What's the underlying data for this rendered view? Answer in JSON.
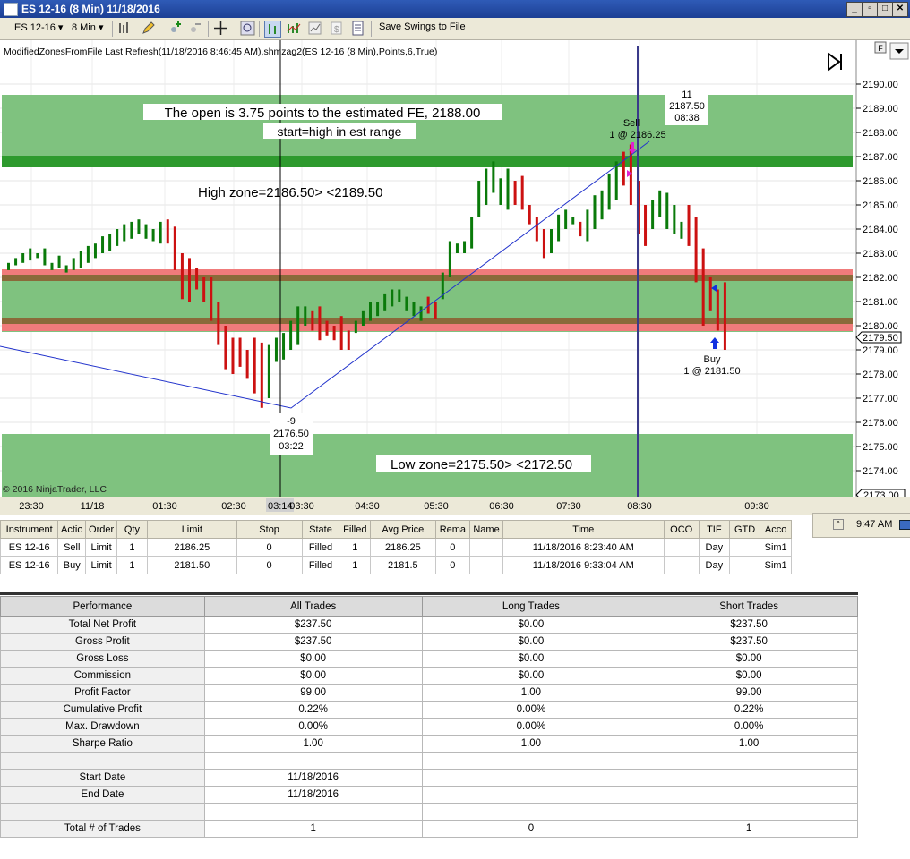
{
  "window": {
    "title": "ES 12-16 (8 Min)  11/18/2016"
  },
  "toolbar": {
    "instrument": "ES 12-16",
    "interval": "8 Min",
    "save_swings": "Save Swings to File"
  },
  "chart": {
    "indicator_label": "ModifiedZonesFromFile Last Refresh(11/18/2016 8:46:45 AM),shmzag2(ES 12-16 (8 Min),Points,6,True)",
    "copyright": "© 2016 NinjaTrader, LLC",
    "panel_button": "F",
    "text_open": "The open is 3.75 points to the estimated FE, 2188.00",
    "text_start": "start=high in est range",
    "text_high_zone": "High  zone=2186.50>  <2189.50",
    "text_low_zone": "Low  zone=2175.50>  <2172.50",
    "swing_high": {
      "count": "11",
      "price": "2187.50",
      "time": "08:38"
    },
    "swing_low": {
      "count": "-9",
      "price": "2176.50",
      "time": "03:22"
    },
    "sell_label": "Sell",
    "sell_fill": "1 @ 2186.25",
    "buy_label": "Buy",
    "buy_fill": "1 @ 2181.50",
    "y_ticks": [
      "2190.00",
      "2189.00",
      "2188.00",
      "2187.00",
      "2186.00",
      "2185.00",
      "2184.00",
      "2183.00",
      "2182.00",
      "2181.00",
      "2180.00",
      "2179.00",
      "2178.00",
      "2177.00",
      "2176.00",
      "2175.00",
      "2174.00"
    ],
    "last_price": "2179.50",
    "bottom_price": "2173.00",
    "x_ticks": [
      "23:30",
      "11/18",
      "01:30",
      "02:30",
      "03:30",
      "04:30",
      "05:30",
      "06:30",
      "07:30",
      "08:30",
      "09:30"
    ],
    "cursor_time": "03:14",
    "colors": {
      "zone": "#7fc27f",
      "zone_line": "#2e9a2e",
      "red_band": "#f07b7b",
      "brown_band": "#8a6a3a",
      "up_bar": "#0a7a0a",
      "down_bar": "#cc1111",
      "swing_line": "#2233cc"
    }
  },
  "orders": {
    "headers": [
      "Instrument",
      "Actio",
      "Order",
      "Qty",
      "Limit",
      "Stop",
      "State",
      "Filled",
      "Avg Price",
      "Rema",
      "Name",
      "Time",
      "OCO",
      "TIF",
      "GTD",
      "Acco"
    ],
    "rows": [
      [
        "ES 12-16",
        "Sell",
        "Limit",
        "1",
        "2186.25",
        "0",
        "Filled",
        "1",
        "2186.25",
        "0",
        "",
        "11/18/2016 8:23:40 AM",
        "",
        "Day",
        "",
        "Sim1"
      ],
      [
        "ES 12-16",
        "Buy",
        "Limit",
        "1",
        "2181.50",
        "0",
        "Filled",
        "1",
        "2181.5",
        "0",
        "",
        "11/18/2016 9:33:04 AM",
        "",
        "Day",
        "",
        "Sim1"
      ]
    ]
  },
  "clock": {
    "time": "9:47 AM"
  },
  "performance": {
    "headers": [
      "Performance",
      "All Trades",
      "Long Trades",
      "Short Trades"
    ],
    "rows": [
      [
        "Total Net Profit",
        "$237.50",
        "$0.00",
        "$237.50"
      ],
      [
        "Gross Profit",
        "$237.50",
        "$0.00",
        "$237.50"
      ],
      [
        "Gross Loss",
        "$0.00",
        "$0.00",
        "$0.00"
      ],
      [
        "Commission",
        "$0.00",
        "$0.00",
        "$0.00"
      ],
      [
        "Profit Factor",
        "99.00",
        "1.00",
        "99.00"
      ],
      [
        "Cumulative Profit",
        "0.22%",
        "0.00%",
        "0.22%"
      ],
      [
        "Max. Drawdown",
        "0.00%",
        "0.00%",
        "0.00%"
      ],
      [
        "Sharpe Ratio",
        "1.00",
        "1.00",
        "1.00"
      ],
      [
        "",
        "",
        "",
        ""
      ],
      [
        "Start Date",
        "11/18/2016",
        "",
        ""
      ],
      [
        "End Date",
        "11/18/2016",
        "",
        ""
      ],
      [
        "",
        "",
        "",
        ""
      ],
      [
        "Total # of Trades",
        "1",
        "0",
        "1"
      ]
    ]
  }
}
